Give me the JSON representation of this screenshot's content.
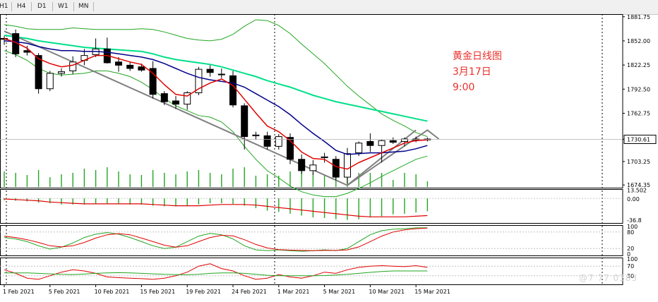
{
  "toolbar": {
    "timeframes": [
      "H1",
      "H4",
      "D1",
      "W1",
      "MN"
    ]
  },
  "annotation": {
    "line1": "黄金日线图",
    "line2": "3月17日",
    "line3": "9:00"
  },
  "watermark": "@7 77 0383",
  "colors": {
    "bull_candle": "#ffffff",
    "bear_candle": "#000000",
    "ma_fast": "#e00000",
    "ma_mid": "#00008b",
    "ma_slow": "#00e08a",
    "bollinger": "#22a622",
    "trendline": "#808080",
    "volume": "#22a622",
    "annotation": "#e8312b"
  },
  "chart_data": [
    {
      "type": "candlestick",
      "title": "",
      "price_axis_labels": [
        "1881.75",
        "1852.00",
        "1822.25",
        "1792.50",
        "1762.75",
        "1730.61",
        "1703.25",
        "1674.35"
      ],
      "current_price": 1730.61,
      "ylim": [
        1671,
        1885
      ],
      "date_labels": [
        "1 Feb 2021",
        "5 Feb 2021",
        "10 Feb 2021",
        "15 Feb 2021",
        "19 Feb 2021",
        "24 Feb 2021",
        "1 Mar 2021",
        "5 Mar 2021",
        "10 Mar 2021",
        "15 Mar 2021"
      ],
      "candles": [
        {
          "o": 1855,
          "h": 1858,
          "l": 1847,
          "c": 1854
        },
        {
          "o": 1861,
          "h": 1866,
          "l": 1832,
          "c": 1836
        },
        {
          "o": 1840,
          "h": 1846,
          "l": 1834,
          "c": 1838
        },
        {
          "o": 1834,
          "h": 1837,
          "l": 1787,
          "c": 1793
        },
        {
          "o": 1793,
          "h": 1815,
          "l": 1790,
          "c": 1812
        },
        {
          "o": 1812,
          "h": 1818,
          "l": 1808,
          "c": 1814
        },
        {
          "o": 1815,
          "h": 1833,
          "l": 1811,
          "c": 1826
        },
        {
          "o": 1828,
          "h": 1842,
          "l": 1822,
          "c": 1834
        },
        {
          "o": 1835,
          "h": 1855,
          "l": 1832,
          "c": 1842
        },
        {
          "o": 1842,
          "h": 1856,
          "l": 1824,
          "c": 1825
        },
        {
          "o": 1826,
          "h": 1832,
          "l": 1814,
          "c": 1822
        },
        {
          "o": 1822,
          "h": 1826,
          "l": 1815,
          "c": 1818
        },
        {
          "o": 1820,
          "h": 1824,
          "l": 1814,
          "c": 1816
        },
        {
          "o": 1818,
          "h": 1827,
          "l": 1781,
          "c": 1786
        },
        {
          "o": 1787,
          "h": 1790,
          "l": 1773,
          "c": 1777
        },
        {
          "o": 1778,
          "h": 1784,
          "l": 1768,
          "c": 1774
        },
        {
          "o": 1774,
          "h": 1790,
          "l": 1767,
          "c": 1788
        },
        {
          "o": 1788,
          "h": 1820,
          "l": 1785,
          "c": 1817
        },
        {
          "o": 1817,
          "h": 1822,
          "l": 1808,
          "c": 1813
        },
        {
          "o": 1811,
          "h": 1818,
          "l": 1806,
          "c": 1811
        },
        {
          "o": 1809,
          "h": 1815,
          "l": 1770,
          "c": 1773
        },
        {
          "o": 1772,
          "h": 1775,
          "l": 1718,
          "c": 1734
        },
        {
          "o": 1735,
          "h": 1740,
          "l": 1730,
          "c": 1736
        },
        {
          "o": 1735,
          "h": 1740,
          "l": 1718,
          "c": 1722
        },
        {
          "o": 1722,
          "h": 1737,
          "l": 1718,
          "c": 1734
        },
        {
          "o": 1733,
          "h": 1738,
          "l": 1700,
          "c": 1706
        },
        {
          "o": 1706,
          "h": 1712,
          "l": 1688,
          "c": 1692
        },
        {
          "o": 1692,
          "h": 1705,
          "l": 1687,
          "c": 1699
        },
        {
          "o": 1708,
          "h": 1714,
          "l": 1702,
          "c": 1709
        },
        {
          "o": 1706,
          "h": 1710,
          "l": 1680,
          "c": 1684
        },
        {
          "o": 1684,
          "h": 1720,
          "l": 1676,
          "c": 1713
        },
        {
          "o": 1714,
          "h": 1728,
          "l": 1710,
          "c": 1726
        },
        {
          "o": 1728,
          "h": 1738,
          "l": 1715,
          "c": 1723
        },
        {
          "o": 1723,
          "h": 1730,
          "l": 1702,
          "c": 1729
        },
        {
          "o": 1729,
          "h": 1733,
          "l": 1725,
          "c": 1727
        },
        {
          "o": 1728,
          "h": 1733,
          "l": 1722,
          "c": 1731
        },
        {
          "o": 1730,
          "h": 1734,
          "l": 1727,
          "c": 1731
        },
        {
          "o": 1731,
          "h": 1733,
          "l": 1728,
          "c": 1730
        }
      ],
      "ma_fast": [
        1855,
        1850,
        1843,
        1830,
        1824,
        1820,
        1822,
        1828,
        1834,
        1834,
        1830,
        1826,
        1823,
        1812,
        1798,
        1786,
        1784,
        1793,
        1800,
        1805,
        1797,
        1780,
        1763,
        1747,
        1740,
        1729,
        1715,
        1707,
        1706,
        1697,
        1694,
        1702,
        1708,
        1714,
        1720,
        1726,
        1729,
        1730
      ],
      "ma_mid": [
        1852,
        1851,
        1849,
        1845,
        1842,
        1840,
        1840,
        1839,
        1839,
        1838,
        1836,
        1834,
        1832,
        1829,
        1824,
        1818,
        1812,
        1807,
        1804,
        1802,
        1800,
        1795,
        1787,
        1779,
        1771,
        1761,
        1749,
        1738,
        1728,
        1717,
        1712,
        1713,
        1714,
        1714,
        1715,
        1716,
        1719,
        1723
      ],
      "bb_upper": [
        1872,
        1870,
        1867,
        1866,
        1866,
        1866,
        1868,
        1867,
        1866,
        1866,
        1866,
        1866,
        1867,
        1866,
        1863,
        1859,
        1855,
        1853,
        1852,
        1854,
        1860,
        1870,
        1878,
        1877,
        1871,
        1861,
        1848,
        1836,
        1824,
        1810,
        1796,
        1784,
        1773,
        1762,
        1754,
        1747,
        1739,
        1734
      ],
      "bb_lower": [
        1840,
        1835,
        1828,
        1818,
        1812,
        1810,
        1811,
        1812,
        1815,
        1815,
        1812,
        1808,
        1801,
        1792,
        1781,
        1772,
        1766,
        1760,
        1758,
        1752,
        1740,
        1722,
        1706,
        1692,
        1683,
        1673,
        1666,
        1662,
        1660,
        1660,
        1664,
        1670,
        1677,
        1685,
        1692,
        1699,
        1706,
        1710
      ],
      "ma_slow": [
        1859,
        1857,
        1855,
        1852,
        1850,
        1848,
        1846,
        1844,
        1843,
        1842,
        1841,
        1840,
        1839,
        1836,
        1832,
        1829,
        1827,
        1825,
        1823,
        1820,
        1816,
        1812,
        1808,
        1803,
        1799,
        1795,
        1790,
        1785,
        1781,
        1777,
        1774,
        1771,
        1768,
        1765,
        1762,
        1759,
        1756,
        1753
      ],
      "volume": [
        22,
        20,
        17,
        24,
        14,
        18,
        20,
        26,
        24,
        28,
        22,
        18,
        17,
        24,
        20,
        18,
        22,
        24,
        20,
        18,
        26,
        28,
        16,
        18,
        16,
        22,
        24,
        20,
        18,
        24,
        24,
        20,
        20,
        20,
        10,
        20,
        18,
        8
      ]
    },
    {
      "type": "bar",
      "title": "",
      "ytick_labels": [
        "13.502",
        "0.00",
        "-36.8"
      ],
      "ylim": [
        -40,
        15
      ],
      "values": [
        -3,
        -4,
        -5,
        -7,
        -8,
        -10,
        -10,
        -10,
        -9,
        -9,
        -9,
        -10,
        -10,
        -12,
        -13,
        -13,
        -12,
        -10,
        -8,
        -8,
        -9,
        -12,
        -16,
        -20,
        -22,
        -25,
        -28,
        -31,
        -32,
        -34,
        -35,
        -34,
        -31,
        -29,
        -26,
        -25,
        -23,
        -21
      ],
      "signal": [
        -1,
        -2,
        -3,
        -4,
        -6,
        -7,
        -8,
        -9,
        -9,
        -9,
        -9,
        -9,
        -9,
        -10,
        -11,
        -12,
        -12,
        -12,
        -11,
        -10,
        -10,
        -10,
        -11,
        -13,
        -15,
        -17,
        -19,
        -21,
        -23,
        -25,
        -27,
        -29,
        -30,
        -30,
        -30,
        -30,
        -29,
        -28
      ]
    },
    {
      "type": "line",
      "title": "",
      "ytick_labels": [
        "100",
        "80",
        "20",
        "0"
      ],
      "ylim": [
        0,
        100
      ],
      "series": [
        {
          "values": [
            60,
            55,
            45,
            30,
            18,
            25,
            40,
            60,
            72,
            78,
            72,
            60,
            45,
            30,
            20,
            25,
            45,
            65,
            75,
            70,
            55,
            30,
            15,
            12,
            15,
            12,
            10,
            12,
            15,
            12,
            20,
            45,
            70,
            85,
            90,
            92,
            95,
            95
          ]
        },
        {
          "values": [
            65,
            60,
            52,
            42,
            30,
            26,
            30,
            42,
            58,
            70,
            74,
            70,
            58,
            45,
            32,
            25,
            30,
            45,
            60,
            68,
            66,
            52,
            35,
            22,
            16,
            14,
            13,
            12,
            13,
            13,
            15,
            26,
            45,
            65,
            80,
            88,
            92,
            94
          ]
        }
      ]
    },
    {
      "type": "line",
      "title": "",
      "ytick_labels": [
        "100",
        "70",
        "30"
      ],
      "ylim": [
        0,
        100
      ],
      "series": [
        {
          "values": [
            55,
            40,
            20,
            15,
            30,
            45,
            55,
            50,
            40,
            25,
            22,
            20,
            18,
            15,
            20,
            30,
            45,
            70,
            80,
            60,
            50,
            30,
            15,
            20,
            35,
            25,
            20,
            30,
            45,
            40,
            55,
            65,
            70,
            72,
            70,
            68,
            72,
            65
          ]
        },
        {
          "values": [
            42,
            42,
            42,
            40,
            38,
            36,
            35,
            37,
            40,
            42,
            43,
            42,
            40,
            38,
            36,
            35,
            34,
            36,
            40,
            42,
            42,
            40,
            36,
            32,
            30,
            30,
            30,
            30,
            31,
            33,
            36,
            40,
            44,
            48,
            50,
            50,
            50,
            50
          ]
        }
      ]
    }
  ]
}
